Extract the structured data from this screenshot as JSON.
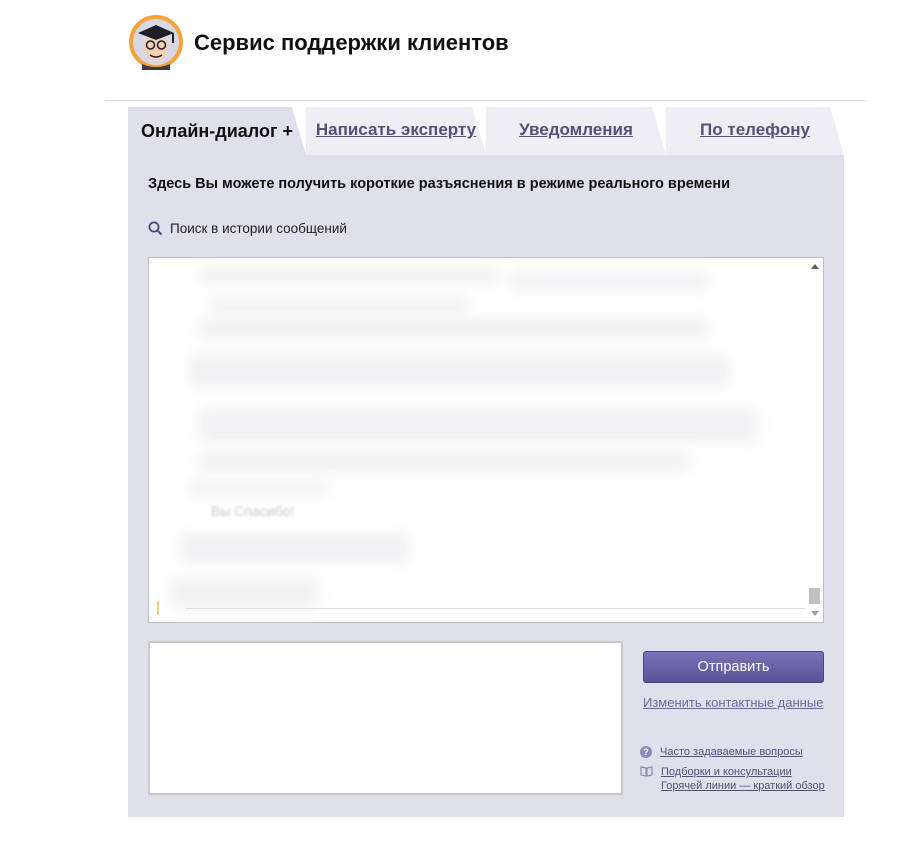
{
  "header": {
    "title": "Сервис поддержки клиентов"
  },
  "tabs": [
    {
      "label": "Онлайн-диалог +",
      "active": true
    },
    {
      "label": "Написать эксперту",
      "active": false
    },
    {
      "label": "Уведомления",
      "active": false
    },
    {
      "label": "По телефону",
      "active": false
    }
  ],
  "main": {
    "intro": "Здесь Вы можете получить короткие разъяснения в режиме реального времени",
    "search_label": "Поиск в истории сообщений",
    "history_fragment": "Вы Спасибо!"
  },
  "compose": {
    "value": "",
    "send_label": "Отправить",
    "change_contacts_label": "Изменить контактные данные"
  },
  "help": {
    "faq_label": "Часто задаваемые вопросы",
    "collections_line1": "Подборки и консультации",
    "collections_line2": "Горячей линии — краткий обзор"
  },
  "colors": {
    "panel": "#e0dfec",
    "accent": "#5b5196",
    "link": "#53507a"
  },
  "icons": {
    "logo": "professor-avatar-logo",
    "search": "search-icon",
    "faq": "question-circle-icon",
    "book": "book-icon"
  }
}
